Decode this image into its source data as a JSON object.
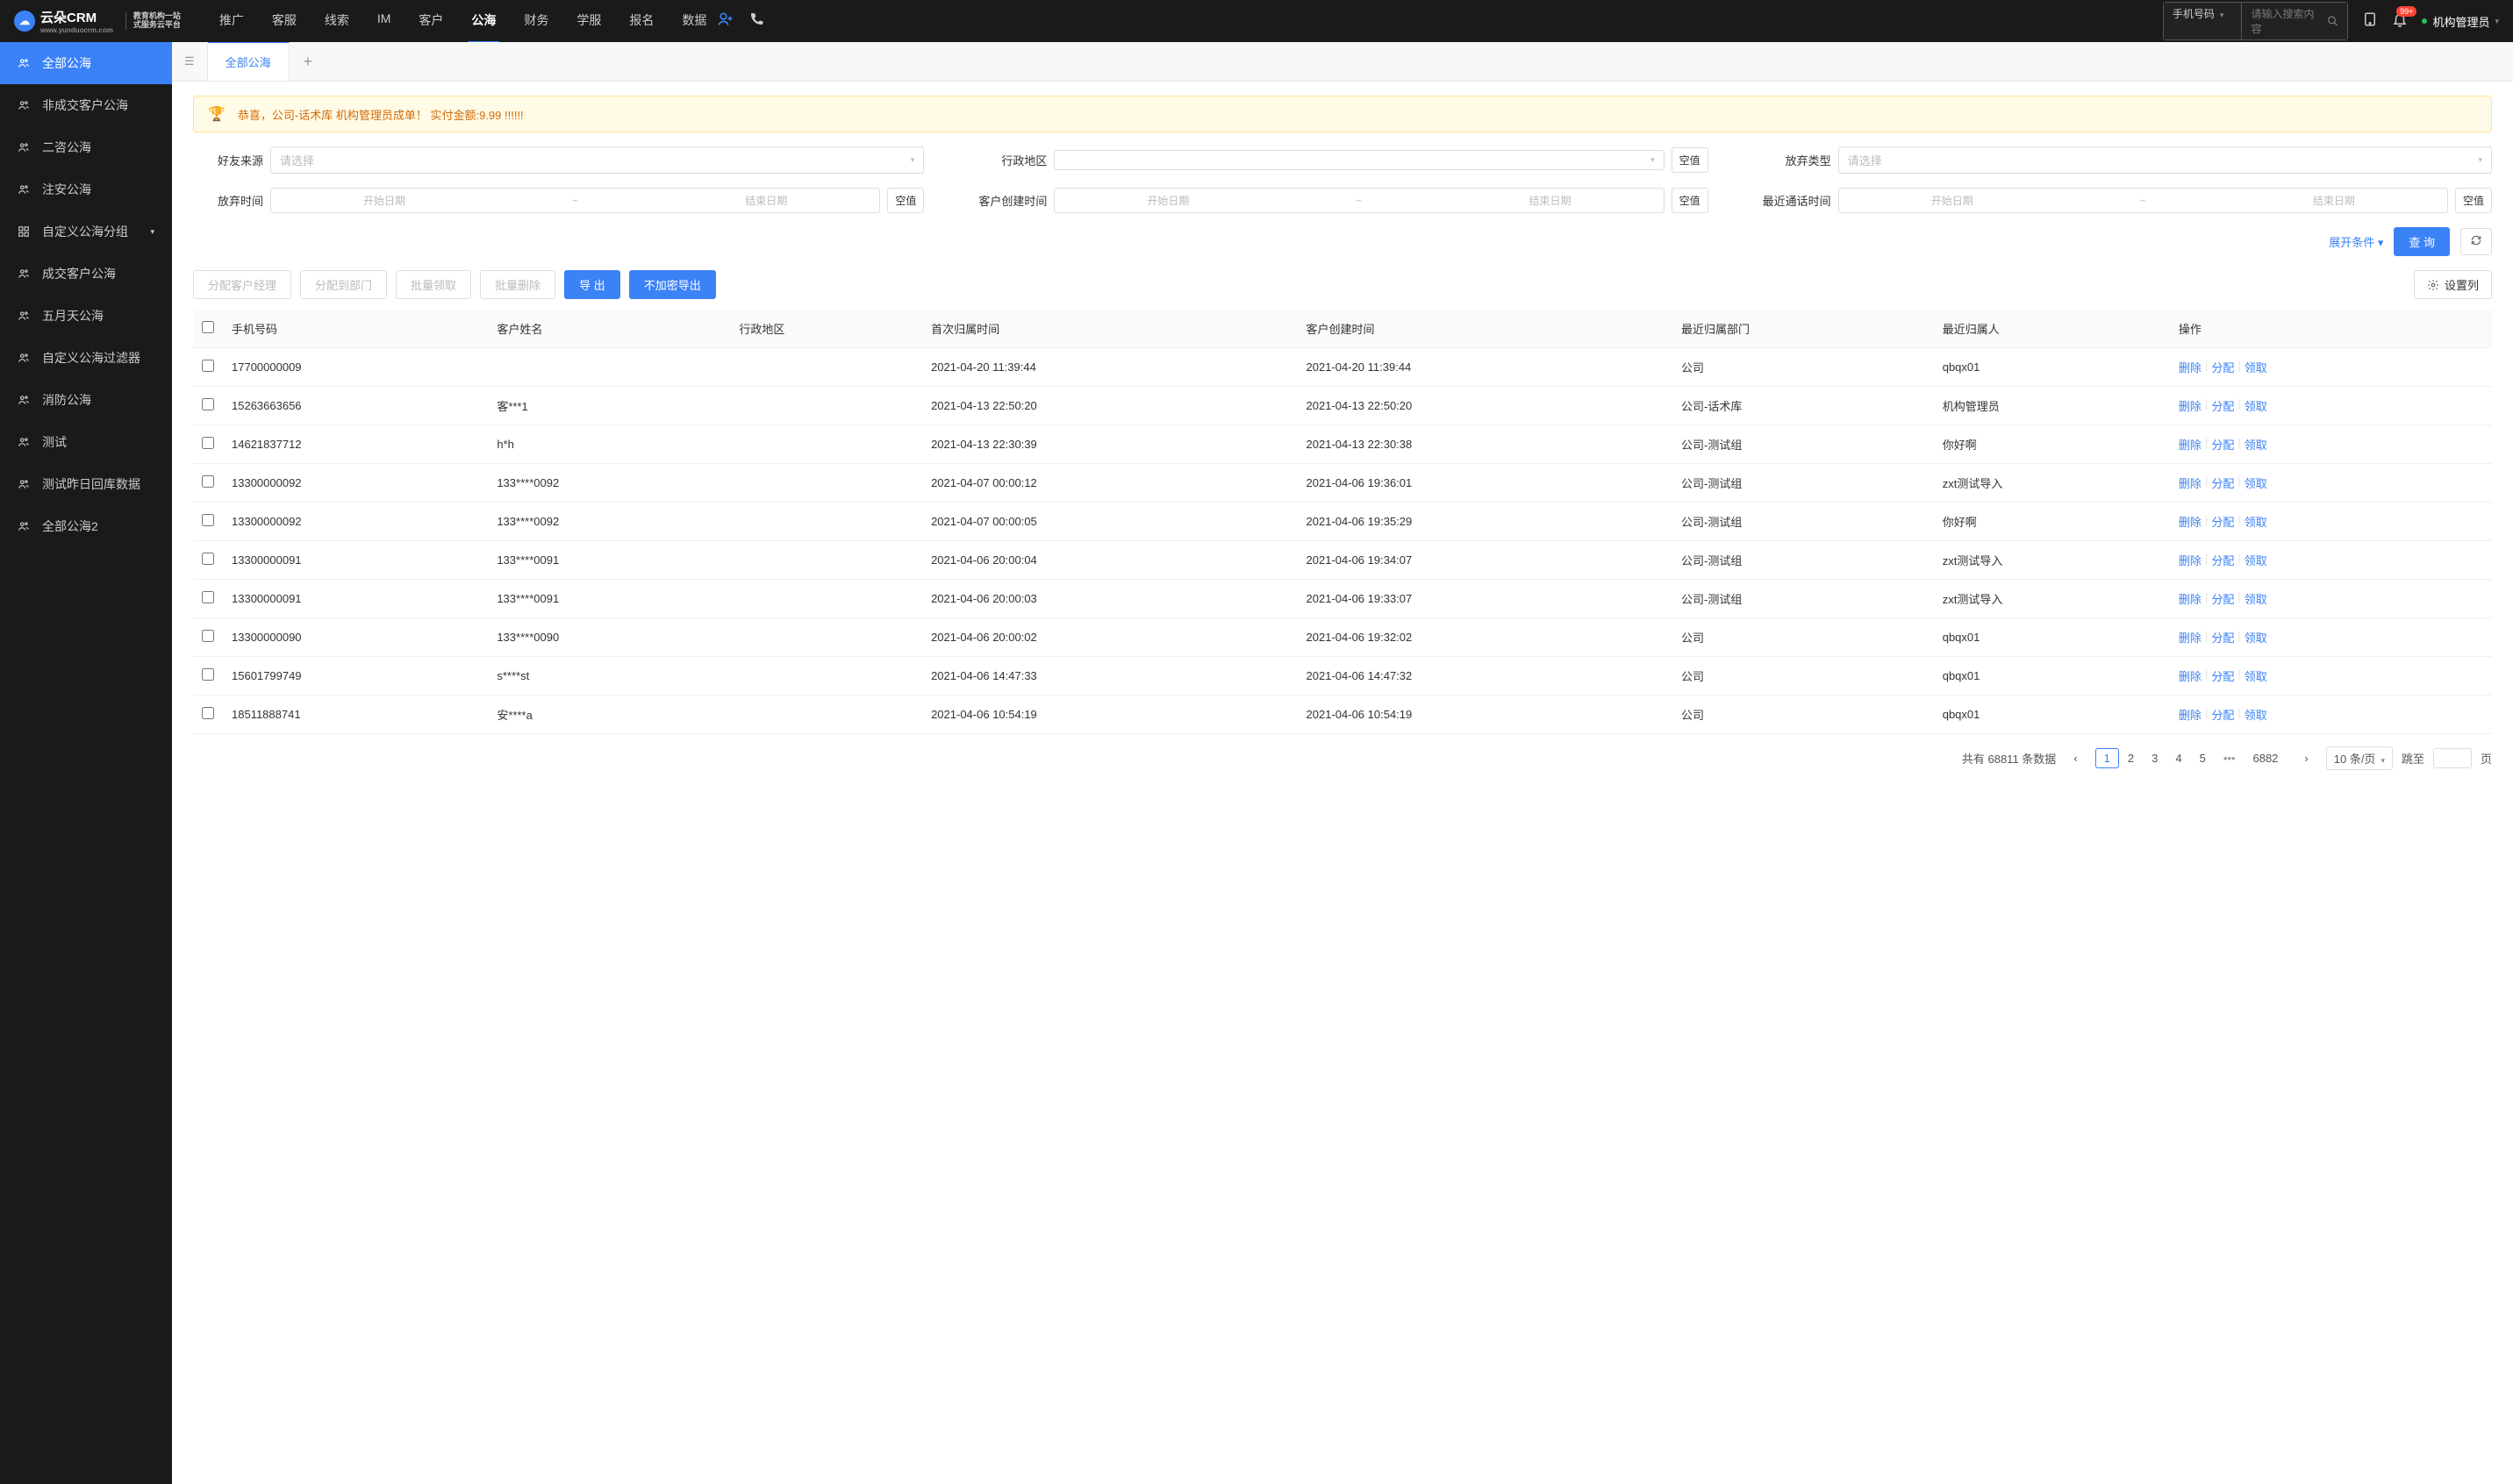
{
  "header": {
    "logo_main": "云朵CRM",
    "logo_url": "www.yunduocrm.com",
    "logo_tag1": "教育机构一站",
    "logo_tag2": "式服务云平台",
    "nav": [
      "推广",
      "客服",
      "线索",
      "IM",
      "客户",
      "公海",
      "财务",
      "学服",
      "报名",
      "数据"
    ],
    "nav_active": 5,
    "search_type": "手机号码",
    "search_placeholder": "请输入搜索内容",
    "badge": "99+",
    "user": "机构管理员"
  },
  "sidebar": [
    {
      "icon": "users",
      "label": "全部公海",
      "active": true
    },
    {
      "icon": "users",
      "label": "非成交客户公海"
    },
    {
      "icon": "users",
      "label": "二咨公海"
    },
    {
      "icon": "users",
      "label": "注安公海"
    },
    {
      "icon": "grid",
      "label": "自定义公海分组",
      "chev": true
    },
    {
      "icon": "users",
      "label": "成交客户公海"
    },
    {
      "icon": "users",
      "label": "五月天公海"
    },
    {
      "icon": "users",
      "label": "自定义公海过滤器"
    },
    {
      "icon": "users",
      "label": "消防公海"
    },
    {
      "icon": "users",
      "label": "测试"
    },
    {
      "icon": "users",
      "label": "测试昨日回库数据"
    },
    {
      "icon": "users",
      "label": "全部公海2"
    }
  ],
  "tabs": {
    "active": "全部公海"
  },
  "banner": "恭喜，公司-话术库  机构管理员成单！  实付金额:9.99 !!!!!!",
  "filters": {
    "friend_source": {
      "label": "好友来源",
      "ph": "请选择"
    },
    "region": {
      "label": "行政地区",
      "clear": "空值"
    },
    "abandon_type": {
      "label": "放弃类型",
      "ph": "请选择"
    },
    "abandon_time": {
      "label": "放弃时间",
      "start": "开始日期",
      "end": "结束日期",
      "clear": "空值"
    },
    "create_time": {
      "label": "客户创建时间",
      "start": "开始日期",
      "end": "结束日期",
      "clear": "空值"
    },
    "call_time": {
      "label": "最近通话时间",
      "start": "开始日期",
      "end": "结束日期",
      "clear": "空值"
    },
    "expand": "展开条件",
    "query": "查 询"
  },
  "toolbar": {
    "assign_mgr": "分配客户经理",
    "assign_dept": "分配到部门",
    "batch_get": "批量领取",
    "batch_del": "批量删除",
    "export": "导 出",
    "export_plain": "不加密导出",
    "set_cols": "设置列"
  },
  "table": {
    "headers": [
      "手机号码",
      "客户姓名",
      "行政地区",
      "首次归属时间",
      "客户创建时间",
      "最近归属部门",
      "最近归属人",
      "操作"
    ],
    "ops": {
      "del": "删除",
      "assign": "分配",
      "get": "领取"
    },
    "rows": [
      {
        "phone": "17700000009",
        "name": "",
        "region": "",
        "first": "2021-04-20 11:39:44",
        "created": "2021-04-20 11:39:44",
        "dept": "公司",
        "owner": "qbqx01"
      },
      {
        "phone": "15263663656",
        "name": "客***1",
        "region": "",
        "first": "2021-04-13 22:50:20",
        "created": "2021-04-13 22:50:20",
        "dept": "公司-话术库",
        "owner": "机构管理员"
      },
      {
        "phone": "14621837712",
        "name": "h*h",
        "region": "",
        "first": "2021-04-13 22:30:39",
        "created": "2021-04-13 22:30:38",
        "dept": "公司-测试组",
        "owner": "你好啊"
      },
      {
        "phone": "13300000092",
        "name": "133****0092",
        "region": "",
        "first": "2021-04-07 00:00:12",
        "created": "2021-04-06 19:36:01",
        "dept": "公司-测试组",
        "owner": "zxt测试导入"
      },
      {
        "phone": "13300000092",
        "name": "133****0092",
        "region": "",
        "first": "2021-04-07 00:00:05",
        "created": "2021-04-06 19:35:29",
        "dept": "公司-测试组",
        "owner": "你好啊"
      },
      {
        "phone": "13300000091",
        "name": "133****0091",
        "region": "",
        "first": "2021-04-06 20:00:04",
        "created": "2021-04-06 19:34:07",
        "dept": "公司-测试组",
        "owner": "zxt测试导入"
      },
      {
        "phone": "13300000091",
        "name": "133****0091",
        "region": "",
        "first": "2021-04-06 20:00:03",
        "created": "2021-04-06 19:33:07",
        "dept": "公司-测试组",
        "owner": "zxt测试导入"
      },
      {
        "phone": "13300000090",
        "name": "133****0090",
        "region": "",
        "first": "2021-04-06 20:00:02",
        "created": "2021-04-06 19:32:02",
        "dept": "公司",
        "owner": "qbqx01"
      },
      {
        "phone": "15601799749",
        "name": "s****st",
        "region": "",
        "first": "2021-04-06 14:47:33",
        "created": "2021-04-06 14:47:32",
        "dept": "公司",
        "owner": "qbqx01"
      },
      {
        "phone": "18511888741",
        "name": "安****a",
        "region": "",
        "first": "2021-04-06 10:54:19",
        "created": "2021-04-06 10:54:19",
        "dept": "公司",
        "owner": "qbqx01"
      }
    ]
  },
  "pagination": {
    "total_label_pre": "共有",
    "total": "68811",
    "total_label_post": " 条数据",
    "pages": [
      "1",
      "2",
      "3",
      "4",
      "5"
    ],
    "last": "6882",
    "per": "10 条/页",
    "jump": "跳至",
    "page_word": "页"
  }
}
